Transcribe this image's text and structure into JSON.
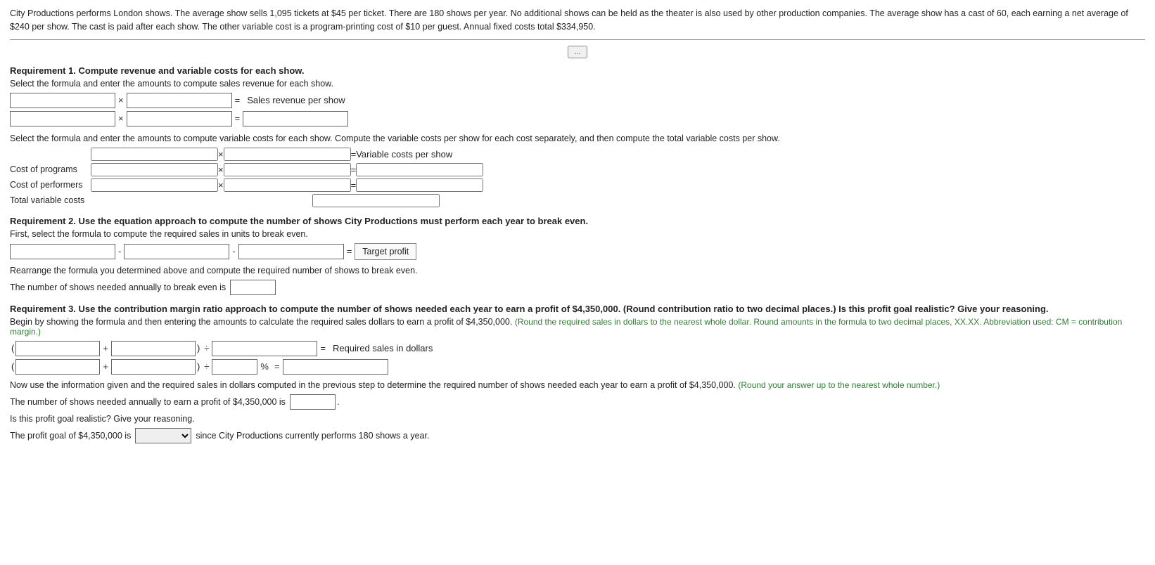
{
  "intro": {
    "text": "City Productions performs London shows. The average show sells 1,095 tickets at $45 per ticket. There are 180 shows per year. No additional shows can be held as the theater is also used by other production companies. The average show has a cast of 60, each earning a net average of $240 per show. The cast is paid after each show. The other variable cost is a program-printing cost of $10 per guest. Annual fixed costs total $334,950."
  },
  "collapsed_btn_label": "...",
  "req1": {
    "title": "Requirement 1.",
    "title_rest": " Compute revenue and variable costs for each show.",
    "instruction1": "Select the formula and enter the amounts to compute sales revenue for each show.",
    "row1_op": "×",
    "row1_eq": "=",
    "row1_label": "Sales revenue per show",
    "row2_op": "×",
    "row2_eq": "=",
    "instruction2": "Select the formula and enter the amounts to compute variable costs for each show. Compute the variable costs per show for each cost separately, and then compute the total variable costs per show.",
    "var_row1_op": "×",
    "var_row1_eq": "=",
    "var_row1_label": "Variable costs per show",
    "var_row2_label": "Cost of programs",
    "var_row2_op": "×",
    "var_row2_eq": "=",
    "var_row3_label": "Cost of performers",
    "var_row3_op": "×",
    "var_row3_eq": "=",
    "var_row4_label": "Total variable costs"
  },
  "req2": {
    "title": "Requirement 2.",
    "title_rest": " Use the equation approach to compute the number of shows City Productions must perform each year to break even.",
    "instruction1": "First, select the formula to compute the required sales in units to break even.",
    "op1": "-",
    "op2": "-",
    "eq": "=",
    "target_profit_label": "Target profit",
    "instruction2": "Rearrange the formula you determined above and compute the required number of shows to break even.",
    "break_even_label": "The number of shows needed annually to break even is"
  },
  "req3": {
    "title": "Requirement 3.",
    "title_rest": " Use the contribution margin ratio approach to compute the number of shows needed each year to earn a profit of $4,350,000. (Round contribution ratio to two decimal places.) Is this profit goal realistic? Give your reasoning.",
    "instruction1": "Begin by showing the formula and then entering the amounts to calculate the required sales dollars to earn a profit of $4,350,000.",
    "note": "(Round the required sales in dollars to the nearest whole dollar. Round amounts in the formula to two decimal places, XX.XX. Abbreviation used: CM = contribution margin.)",
    "row1_paren_open": "(",
    "row1_paren_close": ")",
    "row1_op": "+",
    "row1_div": "÷",
    "row1_eq": "=",
    "row1_label": "Required sales in dollars",
    "row2_paren_open": "(",
    "row2_paren_close": ")",
    "row2_op": "+",
    "row2_div": "÷",
    "row2_pct": "%",
    "row2_eq": "=",
    "instruction2": "Now use the information given and the required sales in dollars computed in the previous step to determine the required number of shows needed each year to earn a profit of $4,350,000.",
    "note2": "(Round your answer up to the nearest whole number.)",
    "shows_label": "The number of shows needed annually to earn a profit of $4,350,000 is",
    "realistic_label": "Is this profit goal realistic? Give your reasoning.",
    "profit_label": "The profit goal of $4,350,000 is",
    "since_label": "since City Productions currently performs 180 shows a year."
  }
}
